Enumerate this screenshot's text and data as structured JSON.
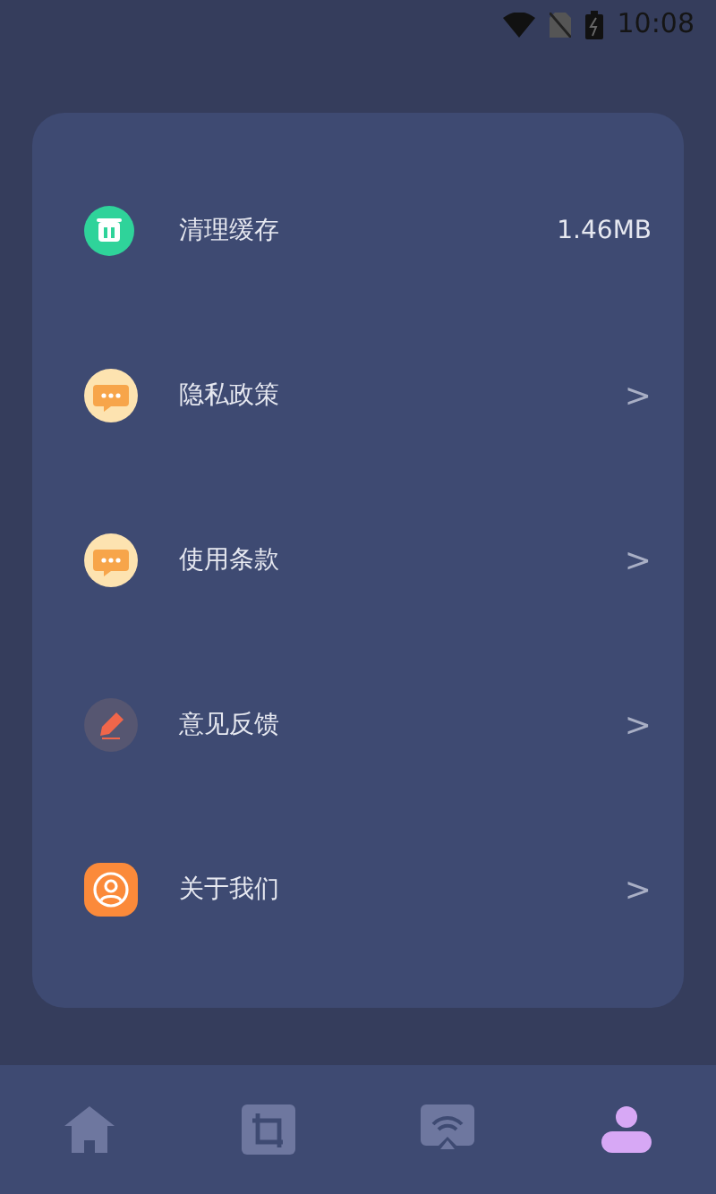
{
  "status_bar": {
    "time": "10:08"
  },
  "settings": [
    {
      "kind": "trash",
      "label": "清理缓存",
      "value": "1.46MB"
    },
    {
      "kind": "chat",
      "label": "隐私政策",
      "chevron": ">"
    },
    {
      "kind": "chat",
      "label": "使用条款",
      "chevron": ">"
    },
    {
      "kind": "pencil",
      "label": "意见反馈",
      "chevron": ">"
    },
    {
      "kind": "user",
      "label": "关于我们",
      "chevron": ">"
    }
  ],
  "bottom_nav": [
    {
      "kind": "home",
      "selected": false
    },
    {
      "kind": "crop",
      "selected": false
    },
    {
      "kind": "cast",
      "selected": false
    },
    {
      "kind": "profile",
      "selected": true
    }
  ]
}
